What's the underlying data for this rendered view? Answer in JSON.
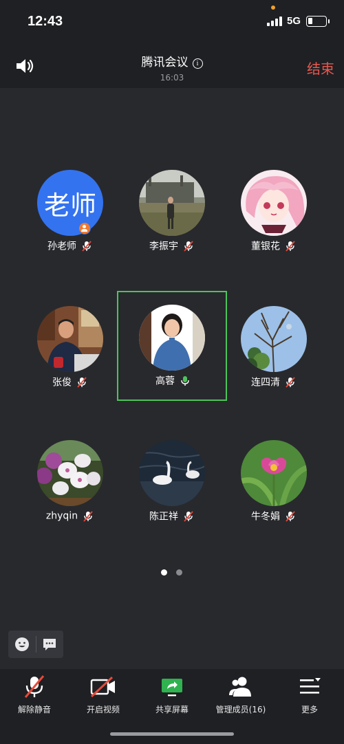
{
  "status_bar": {
    "time": "12:43",
    "network": "5G"
  },
  "header": {
    "title": "腾讯会议",
    "timer": "16:03",
    "end_label": "结束"
  },
  "participants": [
    {
      "name": "孙老师",
      "avatar_text": "老师",
      "mic": "muted",
      "role": "host"
    },
    {
      "name": "李振宇",
      "mic": "muted"
    },
    {
      "name": "董银花",
      "mic": "muted"
    },
    {
      "name": "张俊",
      "mic": "muted"
    },
    {
      "name": "高蓉",
      "mic": "speaking",
      "active": true
    },
    {
      "name": "连四清",
      "mic": "muted"
    },
    {
      "name": "zhyqin",
      "mic": "muted"
    },
    {
      "name": "陈正祥",
      "mic": "muted"
    },
    {
      "name": "牛冬娟",
      "mic": "muted"
    }
  ],
  "pagination": {
    "current": 1,
    "total": 2
  },
  "toolbar": {
    "unmute": "解除静音",
    "video": "开启视频",
    "share": "共享屏幕",
    "members": "管理成员(16)",
    "more": "更多"
  },
  "colors": {
    "background": "#28292d",
    "bar": "#1f2023",
    "end": "#e8584f",
    "active_border": "#4cc45a",
    "muted_red": "#e64a3b",
    "host_avatar": "#3373f0",
    "share_green": "#2fb24f"
  },
  "icons": [
    "speaker-icon",
    "info-icon",
    "mic-muted-icon",
    "mic-active-icon",
    "emoji-icon",
    "chat-icon",
    "video-off-icon",
    "share-screen-icon",
    "members-icon",
    "more-icon"
  ]
}
